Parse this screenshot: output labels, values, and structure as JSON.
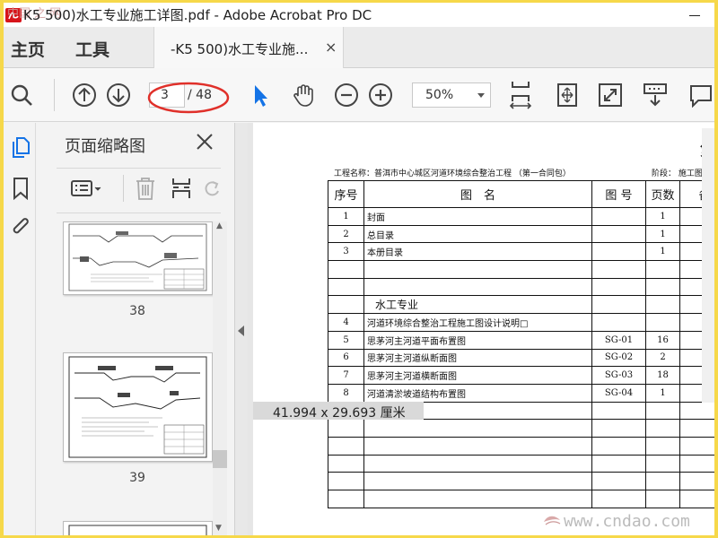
{
  "window": {
    "title": "K5 500)水工专业施工详图.pdf - Adobe Acrobat Pro DC",
    "watermark_top": "中国 之 网"
  },
  "tabs": {
    "home_label": "主页",
    "tools_label": "工具",
    "document_tab_label": "-K5 500)水工专业施...",
    "close_glyph": "×"
  },
  "toolbar": {
    "current_page": "3",
    "total_pages": "/ 48",
    "zoom": "50%",
    "icons": [
      "search-icon",
      "page-up-icon",
      "page-down-icon",
      "select-arrow-icon",
      "hand-icon",
      "zoom-out-icon",
      "zoom-in-icon",
      "fit-page-icon",
      "fit-width-icon",
      "full-screen-icon",
      "read-mode-icon",
      "comment-icon"
    ],
    "accent_color": "#1473e6",
    "highlight_color": "#e0302a"
  },
  "sidebar_rail": {
    "icons": [
      "page-thumbnails-icon",
      "bookmark-icon",
      "attachment-icon"
    ]
  },
  "thumbnails": {
    "title": "页面缩略图",
    "close_glyph": "×",
    "pages": [
      {
        "label": "38"
      },
      {
        "label": "39"
      }
    ]
  },
  "document": {
    "page_heading": "第",
    "project_line": "工程名称：普洱市中心城区河道环境综合整治工程 （第一合同包）",
    "stage_line": "阶段： 施工图设",
    "table": {
      "headers": [
        "序号",
        "图　名",
        "图 号",
        "页数",
        "备注"
      ],
      "rows": [
        {
          "num": "1",
          "name": "封面",
          "code": "",
          "pages": "1"
        },
        {
          "num": "2",
          "name": "总目录",
          "code": "",
          "pages": "1"
        },
        {
          "num": "3",
          "name": "本册目录",
          "code": "",
          "pages": "1"
        },
        {
          "num": "",
          "name": "",
          "code": "",
          "pages": ""
        },
        {
          "num": "",
          "name": "",
          "code": "",
          "pages": ""
        },
        {
          "num": "",
          "name": "水工专业",
          "code": "",
          "pages": "",
          "section": true
        },
        {
          "num": "4",
          "name": "河道环境综合整治工程施工图设计说明□",
          "code": "",
          "pages": ""
        },
        {
          "num": "5",
          "name": "思茅河主河道平面布置图",
          "code": "SG-01",
          "pages": "16"
        },
        {
          "num": "6",
          "name": "思茅河主河道纵断面图",
          "code": "SG-02",
          "pages": "2"
        },
        {
          "num": "7",
          "name": "思茅河主河道横断面图",
          "code": "SG-03",
          "pages": "18"
        },
        {
          "num": "8",
          "name": "河道清淤坡道结构布置图",
          "code": "SG-04",
          "pages": "1"
        },
        {
          "num": "",
          "name": "",
          "code": "",
          "pages": ""
        },
        {
          "num": "",
          "name": "",
          "code": "",
          "pages": ""
        },
        {
          "num": "",
          "name": "",
          "code": "",
          "pages": ""
        },
        {
          "num": "",
          "name": "",
          "code": "",
          "pages": ""
        },
        {
          "num": "",
          "name": "",
          "code": "",
          "pages": ""
        },
        {
          "num": "",
          "name": "",
          "code": "",
          "pages": ""
        }
      ]
    }
  },
  "status": {
    "page_size": "41.994 x 29.693 厘米"
  },
  "watermark": "www.cndao.com"
}
